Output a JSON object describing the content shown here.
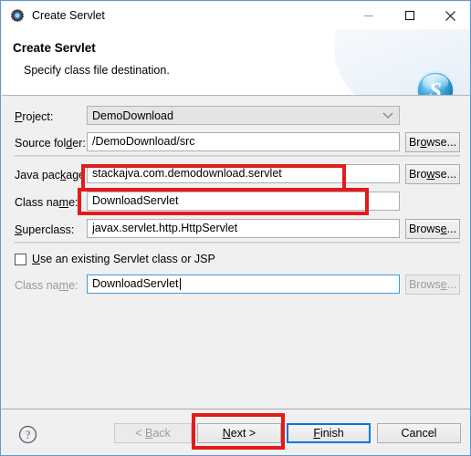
{
  "window": {
    "title": "Create Servlet",
    "icon": "servlet-gear-icon",
    "minimize_label": "–",
    "maximize_label": "□",
    "close_label": "×"
  },
  "header": {
    "title": "Create Servlet",
    "subtitle": "Specify class file destination.",
    "logo": "stackjava-s-logo"
  },
  "form": {
    "project": {
      "label": "Project:",
      "mnemonic": "P",
      "value": "DemoDownload",
      "control": "combobox",
      "enabled": false
    },
    "source_folder": {
      "label": "Source folder:",
      "mnemonic": "d",
      "value": "/DemoDownload/src",
      "browse_label": "Browse...",
      "browse_mnemonic": "o"
    },
    "java_package": {
      "label": "Java package",
      "mnemonic": "k",
      "value": "stackajva.com.demodownload.servlet",
      "browse_label": "Browse...",
      "browse_mnemonic": "w"
    },
    "class_name": {
      "label": "Class name:",
      "mnemonic": "m",
      "value": "DownloadServlet"
    },
    "superclass": {
      "label": "Superclass:",
      "mnemonic": "S",
      "value": "javax.servlet.http.HttpServlet",
      "browse_label": "Browse...",
      "browse_mnemonic": "e"
    },
    "use_existing": {
      "label": "Use an existing Servlet class or JSP",
      "mnemonic": "U",
      "checked": false
    },
    "existing_class_name": {
      "label": "Class name:",
      "mnemonic": "m",
      "value": "DownloadServlet",
      "enabled": false,
      "focused": true,
      "browse_label": "Browse...",
      "browse_mnemonic": "e",
      "browse_enabled": false
    }
  },
  "footer": {
    "help_label": "?",
    "back": {
      "label": "< Back",
      "mnemonic": "B",
      "enabled": false
    },
    "next": {
      "label": "Next >",
      "mnemonic": "N",
      "enabled": true
    },
    "finish": {
      "label": "Finish",
      "mnemonic": "F",
      "default": true
    },
    "cancel": {
      "label": "Cancel",
      "enabled": true
    }
  },
  "annotations": {
    "color": "#e21b1b",
    "boxes": [
      {
        "name": "java-package-highlight"
      },
      {
        "name": "class-name-highlight"
      },
      {
        "name": "next-button-highlight"
      }
    ]
  }
}
